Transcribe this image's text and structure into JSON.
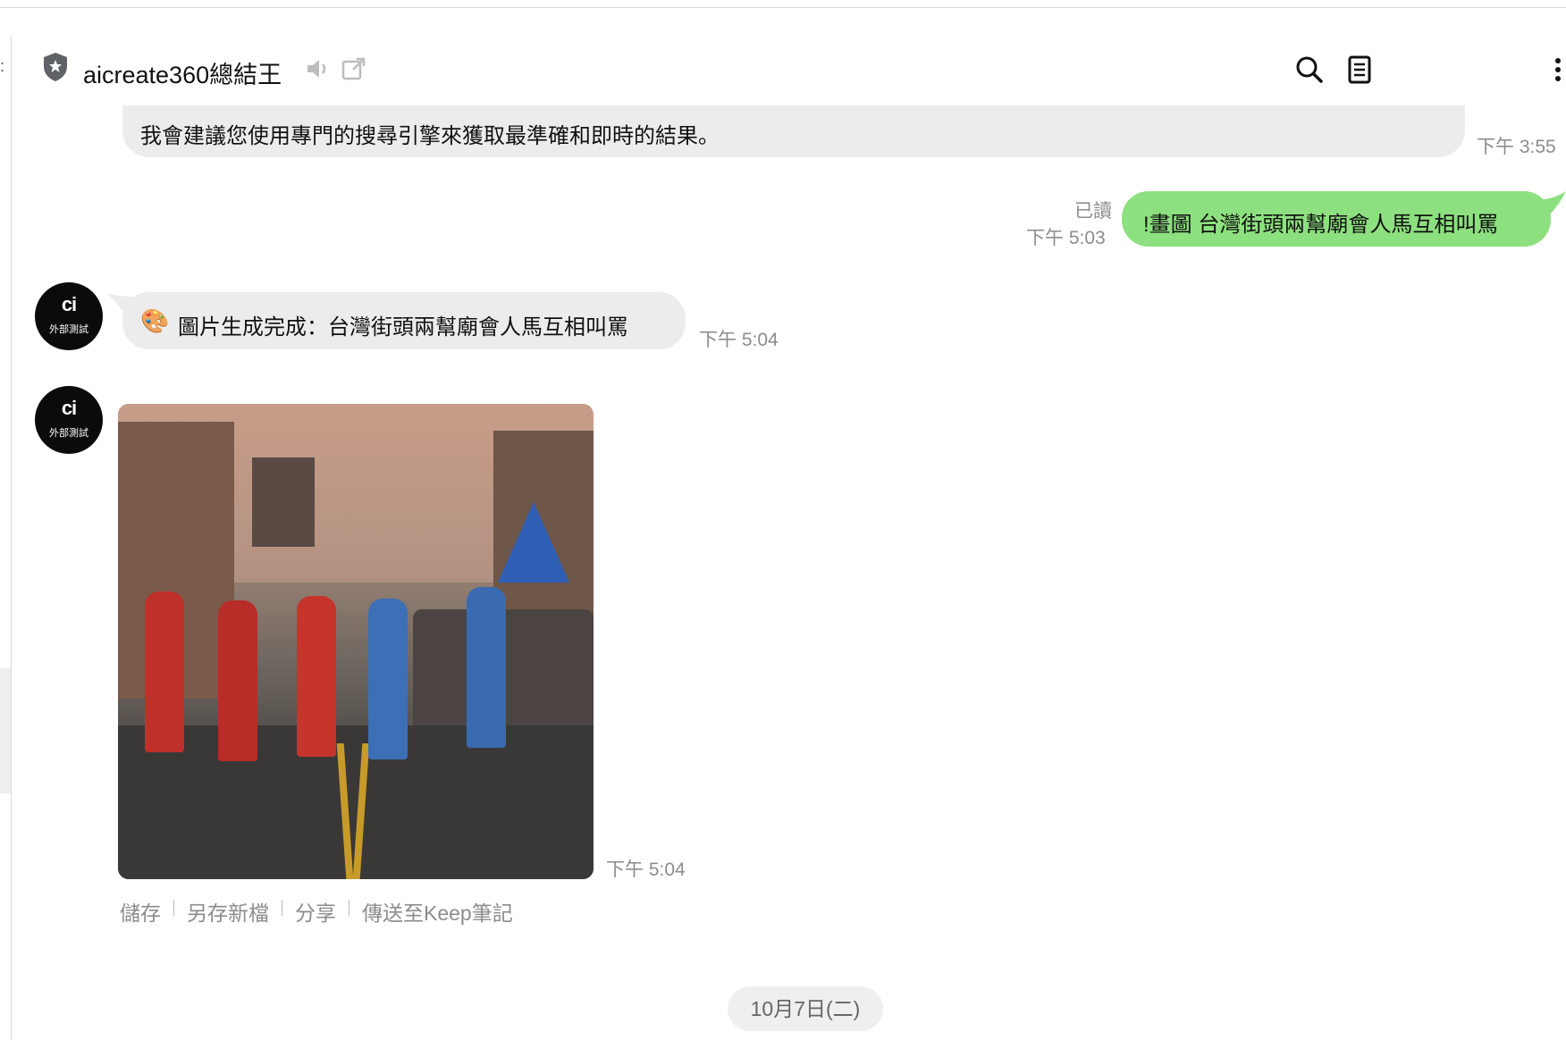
{
  "header": {
    "title": "aicreate360總結王",
    "icons": [
      "shield-star-icon",
      "speaker-icon",
      "popout-icon",
      "search-icon",
      "notes-icon",
      "more-vertical-icon"
    ]
  },
  "messages": [
    {
      "side": "left",
      "text": "我會建議您使用專門的搜尋引擎來獲取最準確和即時的結果。",
      "time": "下午 3:55"
    },
    {
      "side": "right",
      "text": "!畫圖 台灣街頭兩幫廟會人馬互相叫罵",
      "read": "已讀",
      "time": "下午 5:03"
    },
    {
      "side": "left",
      "avatar_logo": "ci",
      "avatar_label": "外部測試",
      "emoji": "🎨",
      "text": "圖片生成完成：台灣街頭兩幫廟會人馬互相叫罵",
      "time": "下午 5:04"
    },
    {
      "side": "left",
      "avatar_logo": "ci",
      "avatar_label": "外部測試",
      "image_alt": "廟會人馬街頭對峙圖",
      "time": "下午 5:04",
      "actions": [
        "儲存",
        "另存新檔",
        "分享",
        "傳送至Keep筆記"
      ]
    }
  ],
  "date_separator": "10月7日(二)",
  "colors": {
    "bubble_gray": "#ececec",
    "bubble_green": "#8de07f",
    "avatar_bg": "#0b0b0b"
  }
}
